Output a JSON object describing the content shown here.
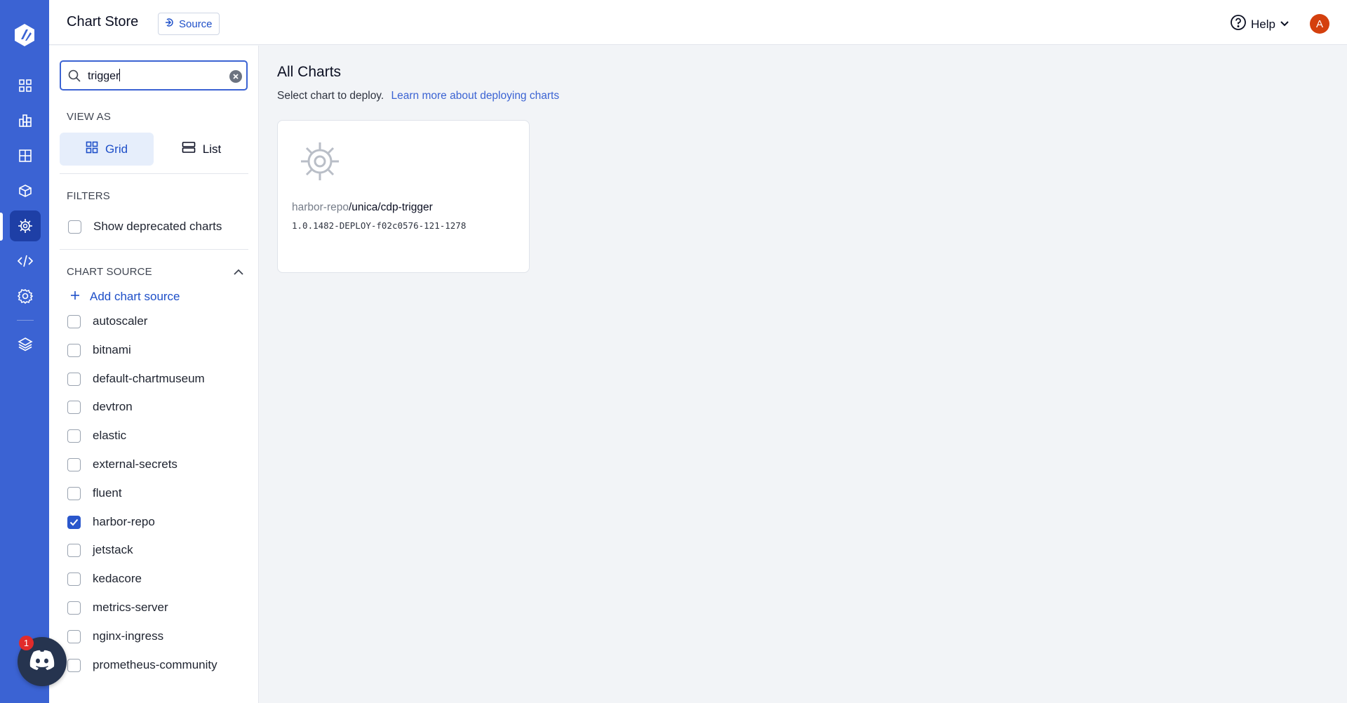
{
  "header": {
    "title": "Chart Store",
    "source_label": "Source",
    "help_label": "Help",
    "avatar_initial": "A",
    "avatar_color": "#d4400e"
  },
  "nav": {
    "items": [
      "app-list-icon",
      "charts-grid-icon",
      "applications-icon",
      "package-icon",
      "chart-store-icon",
      "code-icon",
      "settings-gear-icon",
      "stack-icon"
    ],
    "active": "chart-store-icon",
    "accent": "#3b63d3"
  },
  "sidebar": {
    "search": {
      "value": "trigger",
      "placeholder": ""
    },
    "view_as_label": "VIEW AS",
    "view_grid": "Grid",
    "view_list": "List",
    "filters_label": "FILTERS",
    "show_deprecated": "Show deprecated charts",
    "chart_source_label": "CHART SOURCE",
    "add_chart_source": "Add chart source",
    "sources": [
      {
        "name": "autoscaler",
        "checked": false
      },
      {
        "name": "bitnami",
        "checked": false
      },
      {
        "name": "default-chartmuseum",
        "checked": false
      },
      {
        "name": "devtron",
        "checked": false
      },
      {
        "name": "elastic",
        "checked": false
      },
      {
        "name": "external-secrets",
        "checked": false
      },
      {
        "name": "fluent",
        "checked": false
      },
      {
        "name": "harbor-repo",
        "checked": true
      },
      {
        "name": "jetstack",
        "checked": false
      },
      {
        "name": "kedacore",
        "checked": false
      },
      {
        "name": "metrics-server",
        "checked": false
      },
      {
        "name": "nginx-ingress",
        "checked": false
      },
      {
        "name": "prometheus-community",
        "checked": false
      }
    ]
  },
  "main": {
    "title": "All Charts",
    "subtitle": "Select chart to deploy.",
    "learn_more": "Learn more about deploying charts",
    "cards": [
      {
        "repo": "harbor-repo",
        "path": "/unica/cdp-trigger",
        "version": "1.0.1482-DEPLOY-f02c0576-121-1278"
      }
    ]
  },
  "discord": {
    "badge_count": "1"
  }
}
